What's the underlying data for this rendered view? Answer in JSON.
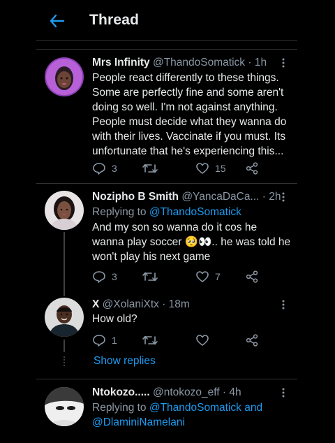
{
  "header": {
    "title": "Thread",
    "back_icon": "arrow-left-icon",
    "accent": "#1d9bf0"
  },
  "tweets": [
    {
      "name": "Mrs Infinity",
      "handle": "@ThandoSomatick",
      "dot": "·",
      "time": "1h",
      "text_lines": [
        "People react differently to these things.",
        "Some are perfectly fine and some aren't",
        "doing so well. I'm not against anything.",
        "People must decide what they wanna do",
        "with their lives. Vaccinate if you must. Its",
        "unfortunate that he's experiencing this..."
      ],
      "replies": "3",
      "retweets": "",
      "likes": "15"
    },
    {
      "name": "Nozipho B Smith",
      "handle": "@YancaDaCa...",
      "dot": "·",
      "time": "2h",
      "replying_label": "Replying to",
      "replying_to": "@ThandoSomatick",
      "text_lines": [
        "And my son so wanna do it cos he",
        "wanna play soccer 🥺👀.. he was told he",
        "won't play his next game"
      ],
      "replies": "3",
      "retweets": "",
      "likes": "7"
    },
    {
      "name": "X",
      "handle": "@XolaniXtx",
      "dot": "·",
      "time": "18m",
      "text_lines": [
        "How old?"
      ],
      "replies": "1",
      "retweets": "",
      "likes": ""
    },
    {
      "name": "Ntokozo.....",
      "handle": "@ntokozo_eff",
      "dot": "·",
      "time": "4h",
      "replying_label": "Replying to",
      "replying_to": "@ThandoSomatick",
      "replying_and": "and",
      "replying_to_2": "@DlaminiNamelani"
    }
  ],
  "show_replies": "Show replies",
  "colors": {
    "background": "#000000",
    "text": "#e7e9ea",
    "secondary": "#8b98a5",
    "link": "#1d9bf0",
    "divider": "#2f3336"
  }
}
